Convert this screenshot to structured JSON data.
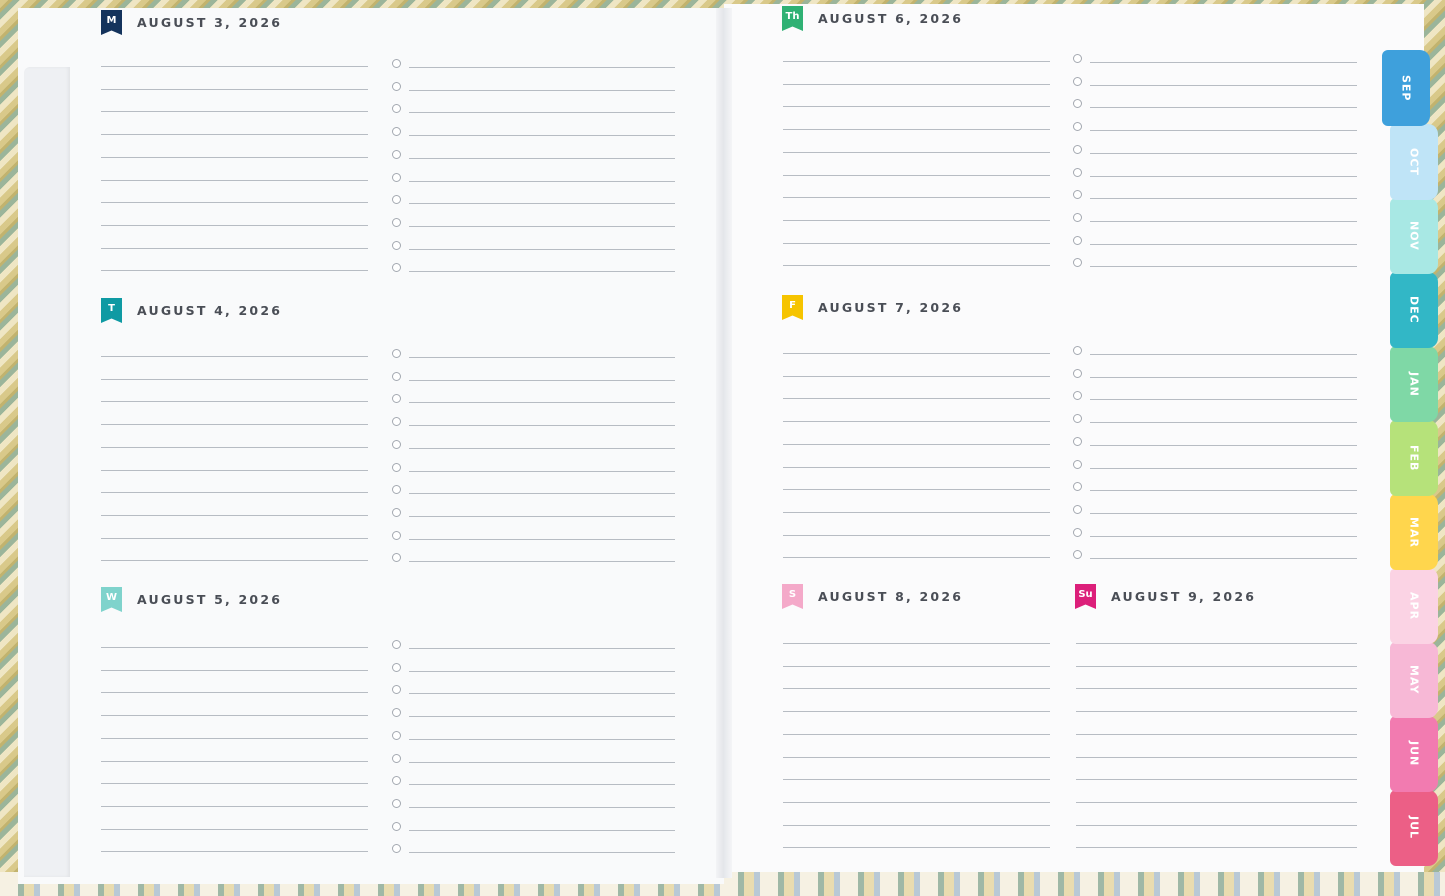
{
  "colors": {
    "monday": "#14335c",
    "tuesday": "#0f9aa3",
    "wednesday": "#7fd3cc",
    "thursday": "#2fb174",
    "friday": "#f6c400",
    "saturday": "#f4a9c9",
    "sunday": "#dc1f7a"
  },
  "days": [
    {
      "abbr": "M",
      "date": "AUGUST 3, 2026"
    },
    {
      "abbr": "T",
      "date": "AUGUST 4, 2026"
    },
    {
      "abbr": "W",
      "date": "AUGUST 5, 2026"
    },
    {
      "abbr": "Th",
      "date": "AUGUST 6, 2026"
    },
    {
      "abbr": "F",
      "date": "AUGUST 7, 2026"
    },
    {
      "abbr": "S",
      "date": "AUGUST 8, 2026"
    },
    {
      "abbr": "Su",
      "date": "AUGUST 9, 2026"
    }
  ],
  "tabs": [
    {
      "label": "SEP",
      "color": "#3ea0dc"
    },
    {
      "label": "OCT",
      "color": "#bfe4f7"
    },
    {
      "label": "NOV",
      "color": "#a8e8e4"
    },
    {
      "label": "DEC",
      "color": "#32b7c6"
    },
    {
      "label": "JAN",
      "color": "#7fd8a6"
    },
    {
      "label": "FEB",
      "color": "#b6e27a"
    },
    {
      "label": "MAR",
      "color": "#ffd64d"
    },
    {
      "label": "APR",
      "color": "#fbd3e4"
    },
    {
      "label": "MAY",
      "color": "#f7b8d6"
    },
    {
      "label": "JUN",
      "color": "#f27bb0"
    },
    {
      "label": "JUL",
      "color": "#ec5f86"
    }
  ]
}
